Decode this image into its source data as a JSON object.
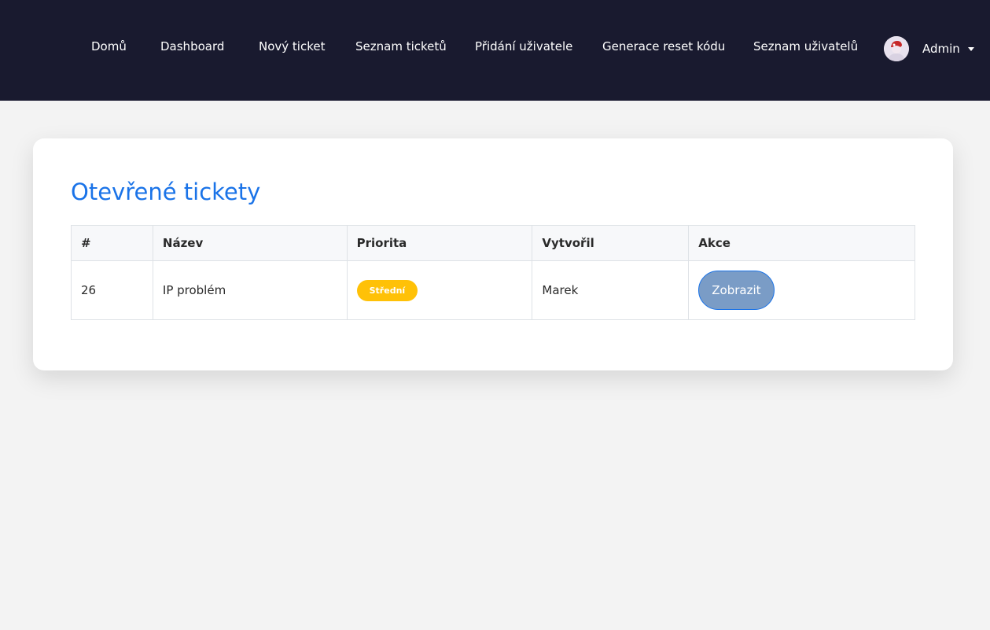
{
  "nav": {
    "items": [
      {
        "label": "Domů"
      },
      {
        "label": "Dashboard"
      },
      {
        "label": "Nový ticket"
      },
      {
        "label": "Seznam ticketů"
      },
      {
        "label": "Přidání uživatele"
      },
      {
        "label": "Generace reset kódu"
      },
      {
        "label": "Seznam uživatelů"
      }
    ],
    "user": {
      "name": "Admin",
      "avatar_icon": "user-avatar-icon"
    }
  },
  "main": {
    "title": "Otevřené tickety",
    "table": {
      "headers": [
        "#",
        "Název",
        "Priorita",
        "Vytvořil",
        "Akce"
      ],
      "rows": [
        {
          "id": "26",
          "name": "IP problém",
          "priority": "Střední",
          "created_by": "Marek",
          "action_label": "Zobrazit"
        }
      ]
    }
  },
  "colors": {
    "navbar_bg": "#191a2f",
    "title_accent": "#1a73e8",
    "priority_medium": "#ffc107",
    "button_bg": "#7a9cc6"
  }
}
